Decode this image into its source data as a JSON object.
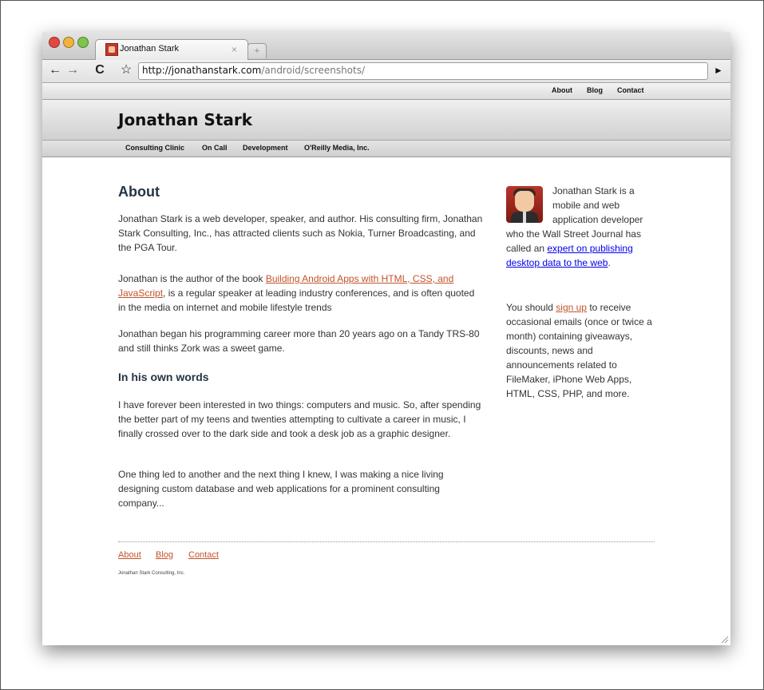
{
  "browser": {
    "tab_title": "Jonathan Stark",
    "tab_close": "×",
    "new_tab": "+",
    "url_host": "http://jonathanstark.com",
    "url_path": "/android/screenshots/",
    "back": "←",
    "forward": "→",
    "reload": "C",
    "star": "☆",
    "go": "►"
  },
  "topnav": [
    "About",
    "Blog",
    "Contact"
  ],
  "site_title": "Jonathan Stark",
  "subnav": [
    "Consulting Clinic",
    "On Call",
    "Development",
    "O'Reilly Media, Inc."
  ],
  "main": {
    "heading": "About",
    "p1": "Jonathan Stark is a web developer, speaker, and author. His consulting firm, Jonathan Stark Consulting, Inc., has attracted clients such as Nokia, Turner Broadcasting, and the PGA Tour.",
    "p2_before": "Jonathan is the author of the book ",
    "p2_link": "Building Android Apps with HTML, CSS, and JavaScript",
    "p2_after": ", is a regular speaker at leading industry conferences, and is often quoted in the media on internet and mobile lifestyle trends",
    "p3": "Jonathan began his programming career more than 20 years ago on a Tandy TRS-80 and still thinks Zork was a sweet game.",
    "subheading": "In his own words",
    "p4": "I have forever been interested in two things: computers and music. So, after spending the better part of my teens and twenties attempting to cultivate a career in music, I finally crossed over to the dark side and took a desk job as a graphic designer.",
    "p5": "One thing led to another and the next thing I knew, I was making a nice living designing custom database and web applications for a prominent consulting company..."
  },
  "sidebar": {
    "bio_before": "Jonathan Stark is a mobile and web application developer who the Wall Street Journal has called an ",
    "bio_link": "expert on publishing desktop data to the web",
    "bio_after": ".",
    "signup_before": "You should ",
    "signup_link": "sign up",
    "signup_after": " to receive occasional emails (once or twice a month) containing giveaways, discounts, news and announcements related to FileMaker, iPhone Web Apps, HTML, CSS, PHP, and more."
  },
  "footer": {
    "links": [
      "About",
      "Blog",
      "Contact"
    ],
    "copyright": "Jonathan Stark Consulting, Inc."
  },
  "colors": {
    "link": "#c2532b",
    "heading": "#253544"
  }
}
